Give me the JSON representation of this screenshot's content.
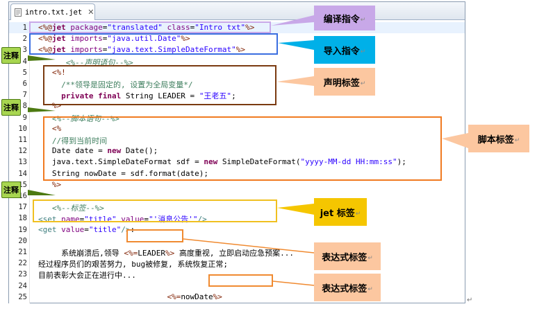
{
  "tab": {
    "label": "intro.txt.jet",
    "close": "✕"
  },
  "lines": [
    {
      "n": "1",
      "segs": [
        [
          "dir",
          "<%@"
        ],
        [
          "kw",
          "jet"
        ],
        [
          "plain",
          " "
        ],
        [
          "attr",
          "package"
        ],
        [
          "plain",
          "="
        ],
        [
          "str",
          "\"translated\""
        ],
        [
          "plain",
          " "
        ],
        [
          "attr",
          "class"
        ],
        [
          "plain",
          "="
        ],
        [
          "str",
          "\"Intro txt\""
        ],
        [
          "dir",
          "%>"
        ]
      ]
    },
    {
      "n": "2",
      "segs": [
        [
          "dir",
          "<%@"
        ],
        [
          "kw",
          "jet"
        ],
        [
          "plain",
          " "
        ],
        [
          "attr",
          "imports"
        ],
        [
          "plain",
          "="
        ],
        [
          "str",
          "\"java.util.Date\""
        ],
        [
          "dir",
          "%>"
        ]
      ]
    },
    {
      "n": "3",
      "segs": [
        [
          "dir",
          "<%@"
        ],
        [
          "kw",
          "jet"
        ],
        [
          "plain",
          " "
        ],
        [
          "attr",
          "imports"
        ],
        [
          "plain",
          "="
        ],
        [
          "str",
          "\"java.text.SimpleDateFormat\""
        ],
        [
          "dir",
          "%>"
        ]
      ]
    },
    {
      "n": "4",
      "segs": [
        [
          "plain",
          "      "
        ],
        [
          "cmt",
          "<%--"
        ],
        [
          "cmti",
          "声明语句"
        ],
        [
          "cmt",
          "--%>"
        ]
      ]
    },
    {
      "n": "5",
      "segs": [
        [
          "plain",
          "   "
        ],
        [
          "dir",
          "<%!"
        ]
      ]
    },
    {
      "n": "6",
      "segs": [
        [
          "plain",
          "     "
        ],
        [
          "cmt",
          "/**领导是固定的, 设置为全局变量*/"
        ]
      ]
    },
    {
      "n": "7",
      "segs": [
        [
          "plain",
          "     "
        ],
        [
          "kw",
          "private final"
        ],
        [
          "plain",
          " String LEADER = "
        ],
        [
          "str",
          "\"王老五\""
        ],
        [
          "plain",
          ";"
        ]
      ]
    },
    {
      "n": "8",
      "segs": [
        [
          "plain",
          "   "
        ],
        [
          "dir",
          "%>"
        ]
      ]
    },
    {
      "n": "9",
      "segs": [
        [
          "plain",
          "   "
        ],
        [
          "cmt",
          "<%--"
        ],
        [
          "cmti",
          "脚本语句"
        ],
        [
          "cmt",
          "--%>"
        ]
      ]
    },
    {
      "n": "10",
      "segs": [
        [
          "plain",
          "   "
        ],
        [
          "dir",
          "<%"
        ]
      ]
    },
    {
      "n": "11",
      "segs": [
        [
          "plain",
          "   "
        ],
        [
          "cmt",
          "//得到当前时间"
        ]
      ]
    },
    {
      "n": "12",
      "segs": [
        [
          "plain",
          "   Date date = "
        ],
        [
          "kw",
          "new"
        ],
        [
          "plain",
          " Date();"
        ]
      ]
    },
    {
      "n": "13",
      "segs": [
        [
          "plain",
          "   java.text.SimpleDateFormat sdf = "
        ],
        [
          "kw",
          "new"
        ],
        [
          "plain",
          " SimpleDateFormat("
        ],
        [
          "str",
          "\"yyyy-MM-dd HH:mm:ss\""
        ],
        [
          "plain",
          ");"
        ]
      ]
    },
    {
      "n": "14",
      "segs": [
        [
          "plain",
          "   String nowDate = sdf.format(date);"
        ]
      ]
    },
    {
      "n": "15",
      "segs": [
        [
          "plain",
          "   "
        ],
        [
          "dir",
          "%>"
        ]
      ]
    },
    {
      "n": "16",
      "segs": []
    },
    {
      "n": "17",
      "segs": [
        [
          "plain",
          "   "
        ],
        [
          "cmt",
          "<%--"
        ],
        [
          "cmti",
          "标签"
        ],
        [
          "cmt",
          "--%>"
        ]
      ]
    },
    {
      "n": "18",
      "segs": [
        [
          "tag",
          "<set"
        ],
        [
          "plain",
          " "
        ],
        [
          "attr",
          "name"
        ],
        [
          "plain",
          "="
        ],
        [
          "str",
          "\"title\""
        ],
        [
          "plain",
          " "
        ],
        [
          "attr",
          "value"
        ],
        [
          "plain",
          "="
        ],
        [
          "str",
          "\"'消息公告'\""
        ],
        [
          "tag",
          "/>"
        ]
      ]
    },
    {
      "n": "19",
      "segs": [
        [
          "tag",
          "<get"
        ],
        [
          "plain",
          " "
        ],
        [
          "attr",
          "value"
        ],
        [
          "plain",
          "="
        ],
        [
          "str",
          "\"title\""
        ],
        [
          "tag",
          "/>"
        ],
        [
          "plain",
          ":"
        ]
      ]
    },
    {
      "n": "20",
      "segs": []
    },
    {
      "n": "21",
      "segs": [
        [
          "plain",
          "     系统崩溃后,领导 "
        ],
        [
          "dir",
          "<%="
        ],
        [
          "plain",
          "LEADER"
        ],
        [
          "dir",
          "%>"
        ],
        [
          "plain",
          " 高度重视, 立即启动应急预案..."
        ]
      ]
    },
    {
      "n": "22",
      "segs": [
        [
          "plain",
          "经过程序员们的艰苦努力, bug被修复, 系统恢复正常;"
        ]
      ]
    },
    {
      "n": "23",
      "segs": [
        [
          "plain",
          "目前表彰大会正在进行中..."
        ]
      ]
    },
    {
      "n": "24",
      "segs": []
    },
    {
      "n": "25",
      "segs": [
        [
          "plain",
          "                            "
        ],
        [
          "dir",
          "<%="
        ],
        [
          "plain",
          "nowDate"
        ],
        [
          "dir",
          "%>"
        ]
      ]
    }
  ],
  "callouts": {
    "compile_directive": "编译指令",
    "import_directive": "导入指令",
    "declaration_tag": "声明标签",
    "script_tag": "脚本标签",
    "jet_tag": "jet 标签",
    "expression_tag_1": "表达式标签",
    "expression_tag_2": "表达式标签",
    "return_mark": "↵"
  },
  "notes": [
    "注释",
    "注释",
    "注释"
  ],
  "colors": {
    "compile_box": "#c8a8e8",
    "import_box": "#3a6ee0",
    "declaration_box": "#7a3a10",
    "script_box": "#f07a20",
    "jet_box": "#f0c020",
    "expression_box": "#f08a30",
    "jet_callout": "#f5c600",
    "light_callout": "#fcc7a0",
    "import_callout": "#00b0e8"
  }
}
